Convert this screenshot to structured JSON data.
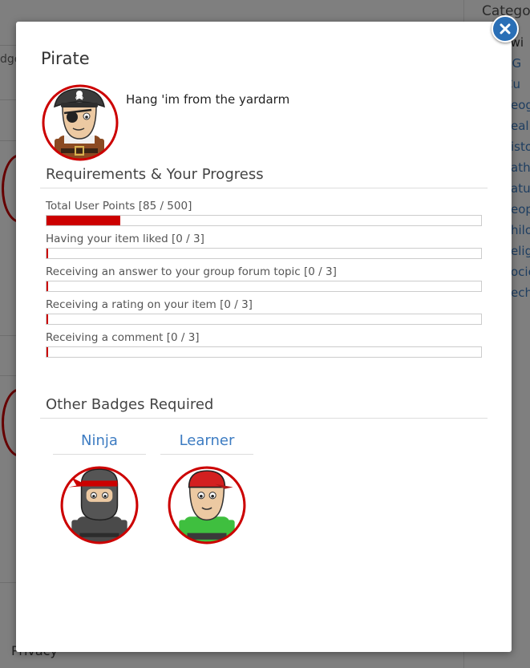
{
  "background": {
    "category_title": "Categor",
    "category_list": [
      "e-wi",
      ", G",
      "Cu",
      "eog",
      "eal",
      "isto",
      "ath",
      "atu",
      "eop",
      "hilo",
      "elig",
      "ocie",
      "ech"
    ],
    "left_text": "dgo",
    "footer_link": "Privacy"
  },
  "modal": {
    "close_icon": "close-icon",
    "badge_name": "Pirate",
    "badge_description": "Hang 'im from the yardarm",
    "requirements_heading": "Requirements & Your Progress",
    "requirements": [
      {
        "label": "Total User Points [85 / 500]",
        "progress": 0.17
      },
      {
        "label": "Having your item liked [0 / 3]",
        "progress": 0
      },
      {
        "label": "Receiving an answer to your group forum topic [0 / 3]",
        "progress": 0
      },
      {
        "label": "Receiving a rating on your item [0 / 3]",
        "progress": 0
      },
      {
        "label": "Receiving a comment [0 / 3]",
        "progress": 0
      }
    ],
    "other_badges_heading": "Other Badges Required",
    "other_badges": [
      {
        "name": "Ninja",
        "icon": "ninja-avatar-icon"
      },
      {
        "name": "Learner",
        "icon": "learner-avatar-icon"
      }
    ],
    "colors": {
      "accent": "#c00000",
      "link": "#3d7cc2",
      "close": "#2a6fb6"
    }
  }
}
